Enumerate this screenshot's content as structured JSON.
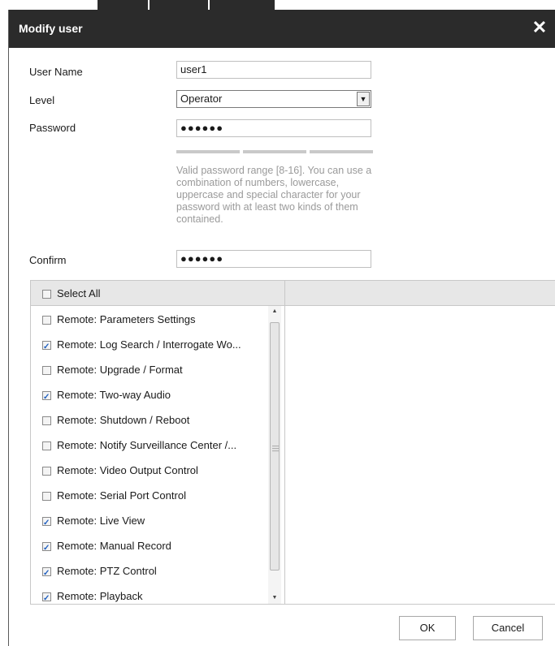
{
  "dialog": {
    "title": "Modify user",
    "close_glyph": "✕"
  },
  "form": {
    "username_label": "User Name",
    "username_value": "user1",
    "level_label": "Level",
    "level_value": "Operator",
    "password_label": "Password",
    "password_value": "●●●●●●",
    "password_hint": "Valid password range [8-16]. You can use a combination of numbers, lowercase, uppercase and special character for your password with at least two kinds of them contained.",
    "confirm_label": "Confirm",
    "confirm_value": "●●●●●●"
  },
  "permissions": {
    "select_all_label": "Select All",
    "select_all_checked": false,
    "items": [
      {
        "label": "Remote: Parameters Settings",
        "checked": false
      },
      {
        "label": "Remote: Log Search / Interrogate Wo...",
        "checked": true
      },
      {
        "label": "Remote: Upgrade / Format",
        "checked": false
      },
      {
        "label": "Remote: Two-way Audio",
        "checked": true
      },
      {
        "label": "Remote: Shutdown / Reboot",
        "checked": false
      },
      {
        "label": "Remote: Notify Surveillance Center /...",
        "checked": false
      },
      {
        "label": "Remote: Video Output Control",
        "checked": false
      },
      {
        "label": "Remote: Serial Port Control",
        "checked": false
      },
      {
        "label": "Remote: Live View",
        "checked": true
      },
      {
        "label": "Remote: Manual Record",
        "checked": true
      },
      {
        "label": "Remote: PTZ Control",
        "checked": true
      },
      {
        "label": "Remote: Playback",
        "checked": true
      }
    ]
  },
  "buttons": {
    "ok_label": "OK",
    "cancel_label": "Cancel"
  },
  "colors": {
    "titlebar": "#2b2b2b",
    "watermark": "#e00000"
  }
}
